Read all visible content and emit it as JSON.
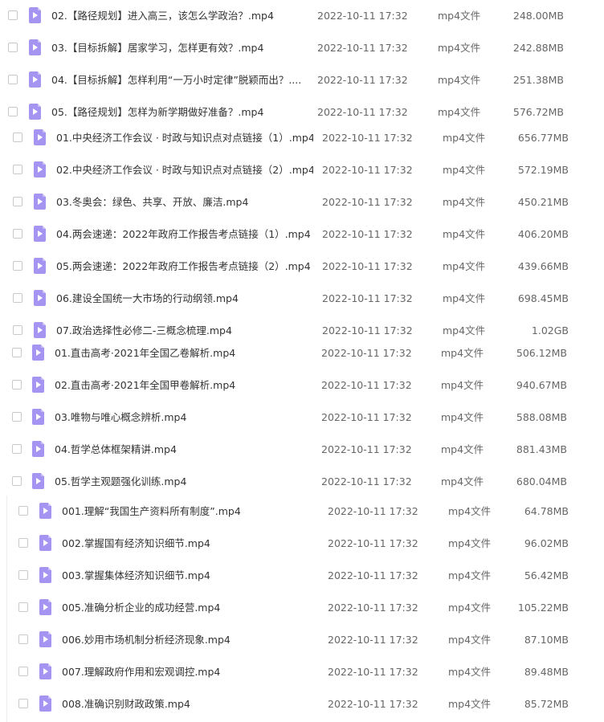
{
  "groups": [
    {
      "files": [
        {
          "name": "02.【路径规划】进入高三，该怎么学政治？.mp4",
          "date": "2022-10-11 17:32",
          "type": "mp4文件",
          "size": "248.00MB"
        },
        {
          "name": "03.【目标拆解】居家学习，怎样更有效？.mp4",
          "date": "2022-10-11 17:32",
          "type": "mp4文件",
          "size": "242.88MB"
        },
        {
          "name": "04.【目标拆解】怎样利用“一万小时定律”脱颖而出？....",
          "date": "2022-10-11 17:32",
          "type": "mp4文件",
          "size": "251.38MB"
        },
        {
          "name": "05.【路径规划】怎样为新学期做好准备？.mp4",
          "date": "2022-10-11 17:32",
          "type": "mp4文件",
          "size": "576.72MB"
        }
      ]
    },
    {
      "files": [
        {
          "name": "01.中央经济工作会议 · 时政与知识点对点链接（1）.mp4",
          "date": "2022-10-11 17:32",
          "type": "mp4文件",
          "size": "656.77MB"
        },
        {
          "name": "02.中央经济工作会议 · 时政与知识点对点链接（2）.mp4",
          "date": "2022-10-11 17:32",
          "type": "mp4文件",
          "size": "572.19MB"
        },
        {
          "name": "03.冬奥会：绿色、共享、开放、廉洁.mp4",
          "date": "2022-10-11 17:32",
          "type": "mp4文件",
          "size": "450.21MB"
        },
        {
          "name": "04.两会速递：2022年政府工作报告考点链接（1）.mp4",
          "date": "2022-10-11 17:32",
          "type": "mp4文件",
          "size": "406.20MB"
        },
        {
          "name": "05.两会速递：2022年政府工作报告考点链接（2）.mp4",
          "date": "2022-10-11 17:32",
          "type": "mp4文件",
          "size": "439.66MB"
        },
        {
          "name": "06.建设全国统一大市场的行动纲领.mp4",
          "date": "2022-10-11 17:32",
          "type": "mp4文件",
          "size": "698.45MB"
        },
        {
          "name": "07.政治选择性必修二-三概念梳理.mp4",
          "date": "2022-10-11 17:32",
          "type": "mp4文件",
          "size": "1.02GB"
        }
      ]
    },
    {
      "files": [
        {
          "name": "01.直击高考·2021年全国乙卷解析.mp4",
          "date": "2022-10-11 17:32",
          "type": "mp4文件",
          "size": "506.12MB"
        },
        {
          "name": "02.直击高考·2021年全国甲卷解析.mp4",
          "date": "2022-10-11 17:32",
          "type": "mp4文件",
          "size": "940.67MB"
        },
        {
          "name": "03.唯物与唯心概念辨析.mp4",
          "date": "2022-10-11 17:32",
          "type": "mp4文件",
          "size": "588.08MB"
        },
        {
          "name": "04.哲学总体框架精讲.mp4",
          "date": "2022-10-11 17:32",
          "type": "mp4文件",
          "size": "881.43MB"
        },
        {
          "name": "05.哲学主观题强化训练.mp4",
          "date": "2022-10-11 17:32",
          "type": "mp4文件",
          "size": "680.04MB"
        }
      ]
    },
    {
      "files": [
        {
          "name": "001.理解“我国生产资料所有制度”.mp4",
          "date": "2022-10-11 17:32",
          "type": "mp4文件",
          "size": "64.78MB"
        },
        {
          "name": "002.掌握国有经济知识细节.mp4",
          "date": "2022-10-11 17:32",
          "type": "mp4文件",
          "size": "96.02MB"
        },
        {
          "name": "003.掌握集体经济知识细节.mp4",
          "date": "2022-10-11 17:32",
          "type": "mp4文件",
          "size": "56.42MB"
        },
        {
          "name": "005.准确分析企业的成功经营.mp4",
          "date": "2022-10-11 17:32",
          "type": "mp4文件",
          "size": "105.22MB"
        },
        {
          "name": "006.妙用市场机制分析经济现象.mp4",
          "date": "2022-10-11 17:32",
          "type": "mp4文件",
          "size": "87.10MB"
        },
        {
          "name": "007.理解政府作用和宏观调控.mp4",
          "date": "2022-10-11 17:32",
          "type": "mp4文件",
          "size": "89.48MB"
        },
        {
          "name": "008.准确识别财政政策.mp4",
          "date": "2022-10-11 17:32",
          "type": "mp4文件",
          "size": "85.72MB"
        }
      ]
    }
  ]
}
